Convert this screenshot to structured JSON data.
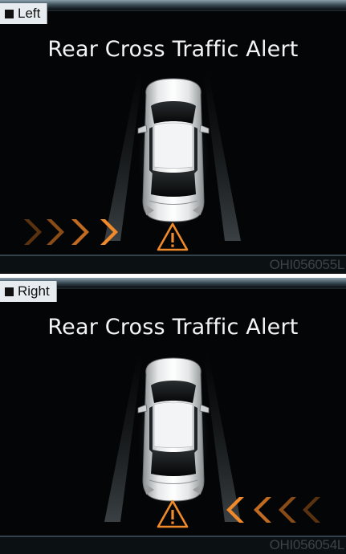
{
  "panels": [
    {
      "tag": "Left",
      "title": "Rear Cross Traffic Alert",
      "code": "OHI056055L",
      "alert_side": "left",
      "arrow_icon": "chevron-right-icon",
      "warning_icon": "warning-triangle-icon"
    },
    {
      "tag": "Right",
      "title": "Rear Cross Traffic Alert",
      "code": "OHI056054L",
      "alert_side": "right",
      "arrow_icon": "chevron-left-icon",
      "warning_icon": "warning-triangle-icon"
    }
  ],
  "colors": {
    "alert_orange": "#f08a2a",
    "screen_bg": "#040506",
    "frame_blue": "#6f8795",
    "title_text": "#f2f4f5"
  }
}
